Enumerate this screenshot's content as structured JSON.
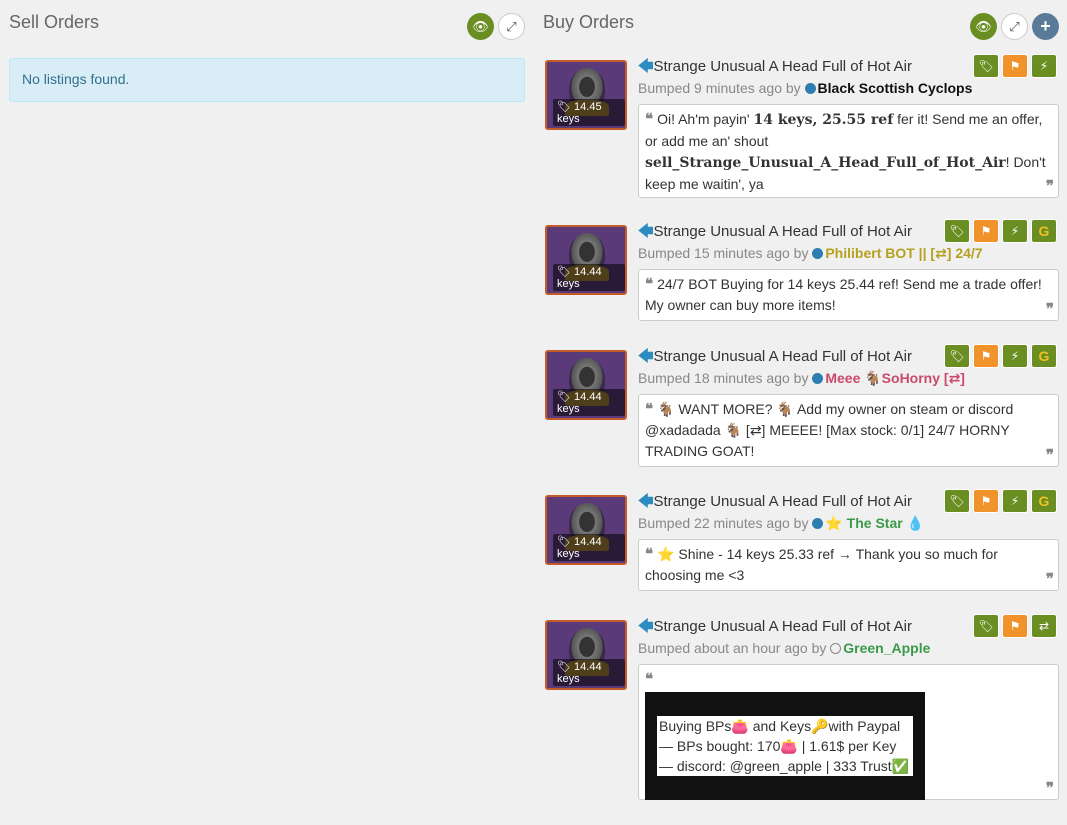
{
  "sell": {
    "title": "Sell Orders",
    "empty_message": "No listings found."
  },
  "buy": {
    "title": "Buy Orders",
    "listings": [
      {
        "price": "14.45 keys",
        "title": "Strange Unusual A Head Full of Hot Air",
        "bumped": "Bumped 9 minutes ago by",
        "user": "Black Scottish Cyclops",
        "user_color": "#111111",
        "comment_parts": [
          "Oi! Ah'm payin' ",
          "14 keys, 25.55 ref",
          " fer it! Send me an offer, or add me an' shout ",
          "sell_Strange_Unusual_A_Head_Full_of_Hot_Air",
          "! Don't keep me waitin', ya"
        ]
      },
      {
        "price": "14.44 keys",
        "title": "Strange Unusual A Head Full of Hot Air",
        "bumped": "Bumped 15 minutes ago by",
        "user": "Philibert BOT || [⇄] 24/7",
        "user_color": "#b5a020",
        "comment": "24/7 BOT Buying for 14 keys 25.44 ref! Send me a trade offer! My owner can buy more items!"
      },
      {
        "price": "14.44 keys",
        "title": "Strange Unusual A Head Full of Hot Air",
        "bumped": "Bumped 18 minutes ago by",
        "user": "Meee 🐐SoHorny [⇄]",
        "user_color": "#c94a6a",
        "comment": "🐐 WANT MORE? 🐐 Add my owner on steam or discord @xadadada 🐐 [⇄] MEEEE! [Max stock: 0/1] 24/7 HORNY TRADING GOAT!"
      },
      {
        "price": "14.44 keys",
        "title": "Strange Unusual A Head Full of Hot Air",
        "bumped": "Bumped 22 minutes ago by",
        "user": "⭐ The Star 💧",
        "user_color": "#3a9a4a",
        "comment": "⭐ Shine - 14 keys 25.33 ref → Thank you so much for choosing me <3"
      },
      {
        "price": "14.44 keys",
        "title": "Strange Unusual A Head Full of Hot Air",
        "bumped": "Bumped about an hour ago by",
        "user": "Green_Apple",
        "user_color": "#3a9a4a",
        "comment_lines": [
          "Buying BPs👛 and Keys🔑with Paypal",
          "— BPs bought: 170👛 | 1.61$ per Key",
          "— discord: @green_apple | 333 Trust✅"
        ]
      }
    ]
  },
  "colors": {
    "accent_green": "#6b8e23",
    "accent_orange": "#f0932b",
    "arrow_blue": "#2e8bc0"
  }
}
